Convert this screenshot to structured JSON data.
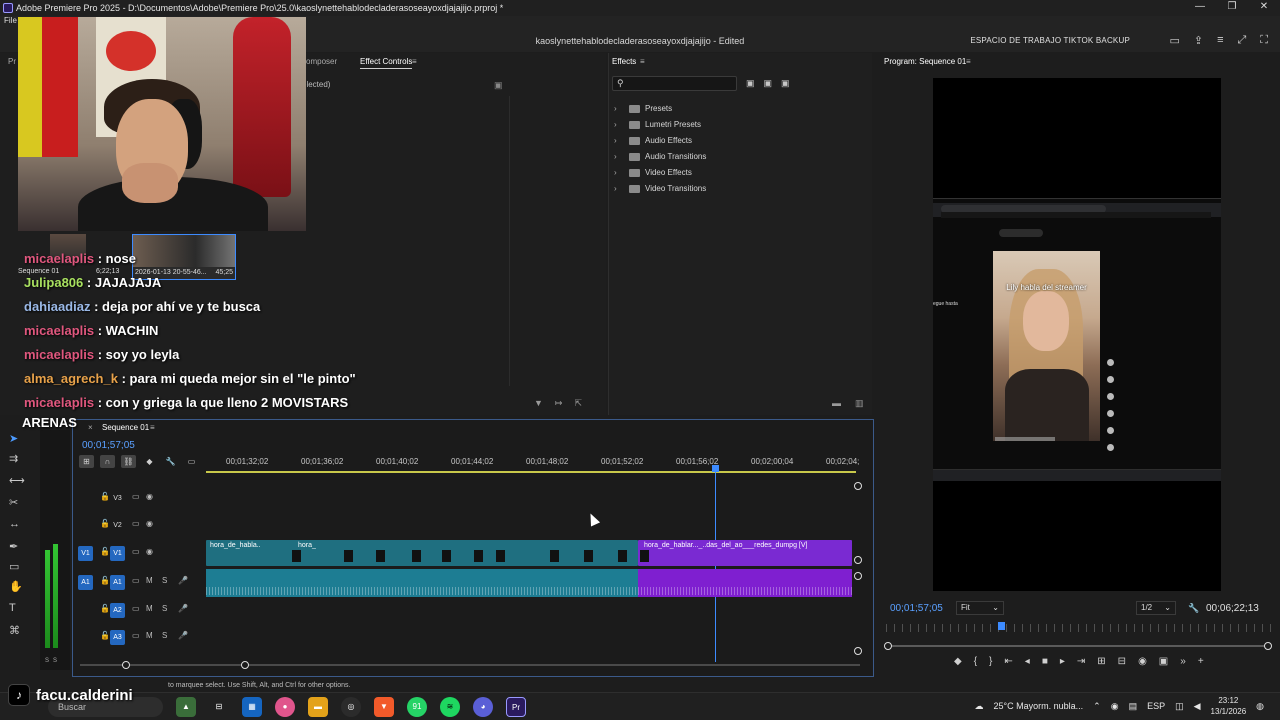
{
  "window": {
    "title": "Adobe Premiere Pro 2025 - D:\\Documentos\\Adobe\\Premiere Pro\\25.0\\kaoslynettehablodecladerasoseayoxdjajajijo.prproj *",
    "buttons": [
      "—",
      "❐",
      "✕"
    ]
  },
  "menu": {
    "file": "File"
  },
  "header": {
    "project_title": "kaoslynettehablodecladerasoseayoxdjajajijo - Edited",
    "workspace": "ESPACIO DE TRABAJO TIKTOK BACKUP"
  },
  "effect_controls": {
    "tab_left": "Pr",
    "tab_composer": "omposer",
    "tab_active": "Effect Controls",
    "no_clip": "elected)"
  },
  "effects": {
    "title": "Effects",
    "items": [
      "Presets",
      "Lumetri Presets",
      "Audio Effects",
      "Audio Transitions",
      "Video Effects",
      "Video Transitions"
    ]
  },
  "program": {
    "title": "Program: Sequence 01",
    "timecode": "00;01;57;05",
    "fit": "Fit",
    "resolution": "1/2",
    "duration": "00;06;22;13",
    "video_caption": "Lily habla del streamer",
    "side_text": "egue hasta"
  },
  "project_bin": {
    "sequence_label": "Sequence 01",
    "sequence_time": "6;22;13",
    "date": "2026-01-13 20-55-46...",
    "dur": "45;25"
  },
  "timeline": {
    "title": "Sequence 01",
    "timecode": "00;01;57;05",
    "ruler": [
      "00;01;32;02",
      "00;01;36;02",
      "00;01;40;02",
      "00;01;44;02",
      "00;01;48;02",
      "00;01;52;02",
      "00;01;56;02",
      "00;02;00;04",
      "00;02;04;"
    ],
    "tracks": [
      {
        "name": "V3",
        "target": ""
      },
      {
        "name": "V2",
        "target": ""
      },
      {
        "name": "V1",
        "target": "V1"
      },
      {
        "name": "A1",
        "target": "A1"
      },
      {
        "name": "A2",
        "target": ""
      },
      {
        "name": "A3",
        "target": ""
      }
    ],
    "clips": {
      "v1_first": "hora_de_habla..",
      "v1_second": "hora_",
      "v1_purple": "hora_de_hablar..._..das_del_ao___redes_dumpg [V]"
    }
  },
  "meter": {
    "labels": [
      "S",
      "S"
    ]
  },
  "status": "to marquee select. Use Shift, Alt, and Ctrl for other options.",
  "chat": [
    {
      "user": "micaelaplis",
      "msg": ": nose",
      "color": "#e0577e"
    },
    {
      "user": "Julipa806",
      "msg": ": JAJAJAJA",
      "color": "#a8e05f"
    },
    {
      "user": "dahiaadiaz",
      "msg": ": deja por ahí ve y te busca",
      "color": "#9ab8e6"
    },
    {
      "user": "micaelaplis",
      "msg": ": WACHIN",
      "color": "#e0577e"
    },
    {
      "user": "micaelaplis",
      "msg": ": soy yo leyla",
      "color": "#e0577e"
    },
    {
      "user": "alma_agrech_k",
      "msg": ": para mi queda mejor sin el \"le pinto\"",
      "color": "#e8a24a"
    },
    {
      "user": "micaelaplis",
      "msg": ": con y griega la que lleno 2 MOVISTARS",
      "color": "#e0577e"
    }
  ],
  "chat_tail": "ARENAS",
  "tiktok": {
    "handle": "facu.calderini"
  },
  "taskbar": {
    "search": "Buscar",
    "weather": "25°C  Mayorm. nubla...",
    "lang": "ESP",
    "time": "23:12",
    "date": "13/1/2026",
    "whatsapp_badge": "91"
  },
  "colors": {
    "accent": "#3d8bff",
    "clip_teal": "#1f6f80",
    "clip_purple": "#7a2ad2",
    "audio_teal": "#1d7d93",
    "audio_purple": "#7f1fd0"
  }
}
